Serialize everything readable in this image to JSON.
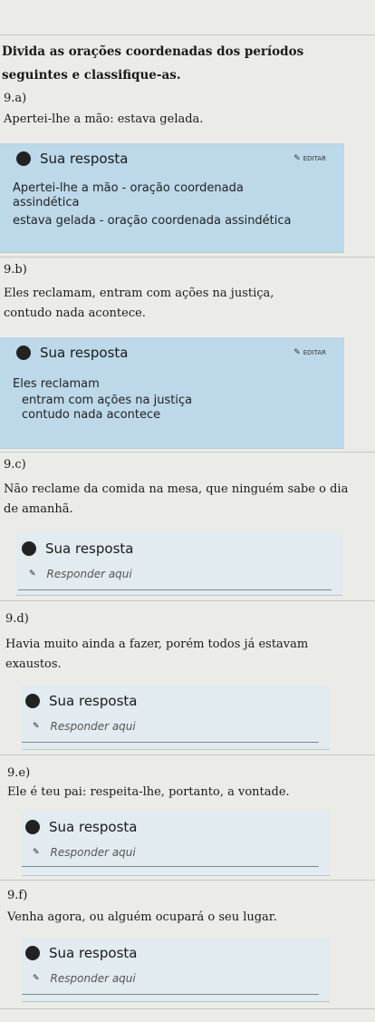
{
  "intro": "Divida as orações coordenadas dos períodos seguintes e classifique-as.",
  "questions": [
    {
      "num": "9.a)",
      "text": "Apertei-lhe a mão: estava gelada.",
      "card_title": "Sua resposta",
      "edit_label": "EDITAR",
      "answer_lines": [
        "Apertei-lhe a mão - oração coordenada",
        "assindética",
        "estava gelada - oração coordenada assindética"
      ]
    },
    {
      "num": "9.b)",
      "text": "Eles reclamam, entram com ações na justiça, contudo nada acontece.",
      "card_title": "Sua resposta",
      "edit_label": "EDITAR",
      "answer_lines": [
        "Eles reclamam",
        "entram com ações na justiça",
        "contudo nada acontece"
      ]
    },
    {
      "num": "9.c)",
      "text": "Não reclame da comida na mesa, que ninguém sabe o dia de amanhã.",
      "card_title": "Sua resposta",
      "placeholder": "Responder aqui"
    },
    {
      "num": "9.d)",
      "text": "Havia muito ainda a fazer, porém todos já estavam exaustos.",
      "card_title": "Sua resposta",
      "placeholder": "Responder aqui"
    },
    {
      "num": "9.e)",
      "text": "Ele é teu pai: respeita-lhe, portanto, a vontade.",
      "card_title": "Sua resposta",
      "placeholder": "Responder aqui"
    },
    {
      "num": "9.f)",
      "text": "Venha agora, ou alguém ocupará o seu lugar.",
      "card_title": "Sua resposta",
      "placeholder": "Responder aqui"
    }
  ]
}
